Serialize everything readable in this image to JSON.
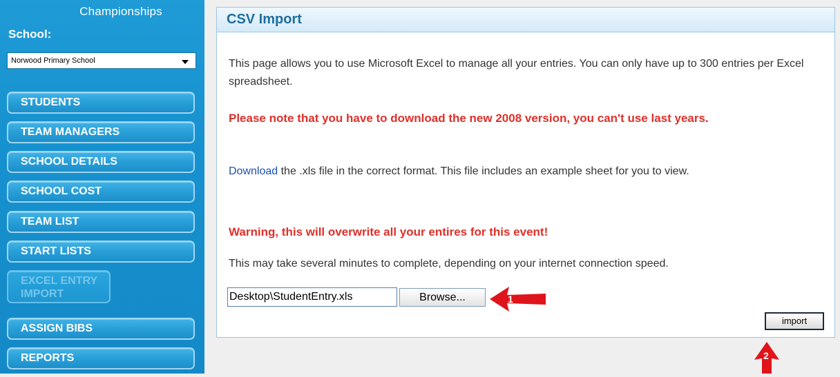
{
  "sidebar": {
    "title": "Championships",
    "school_label": "School:",
    "school_select": "Norwood Primary School",
    "nav": [
      {
        "label": "STUDENTS"
      },
      {
        "label": "TEAM MANAGERS"
      },
      {
        "label": "SCHOOL DETAILS"
      },
      {
        "label": "SCHOOL COST"
      },
      {
        "label": "TEAM LIST"
      },
      {
        "label": "START LISTS"
      },
      {
        "label": "EXCEL ENTRY IMPORT",
        "state": "disabled"
      },
      {
        "label": "ASSIGN BIBS"
      },
      {
        "label": "REPORTS"
      }
    ]
  },
  "panel": {
    "title": "CSV Import",
    "intro": "This page allows you to use Microsoft Excel to manage all your entries. You can only have up to 300 entries per Excel spreadsheet.",
    "note": "Please note that you have to download the new 2008 version, you can't use last years.",
    "download_link": "Download",
    "download_text": " the .xls file in the correct format. This file includes an example sheet for you to view.",
    "warning": "Warning, this will overwrite all your entires for this event!",
    "time_note": "This may take several minutes to complete, depending on your internet connection speed.",
    "file_value": "Desktop\\StudentEntry.xls",
    "browse_label": "Browse...",
    "import_label": "import"
  },
  "annotations": {
    "step1": "1",
    "step2": "2",
    "arrow_color": "#e0141b"
  }
}
